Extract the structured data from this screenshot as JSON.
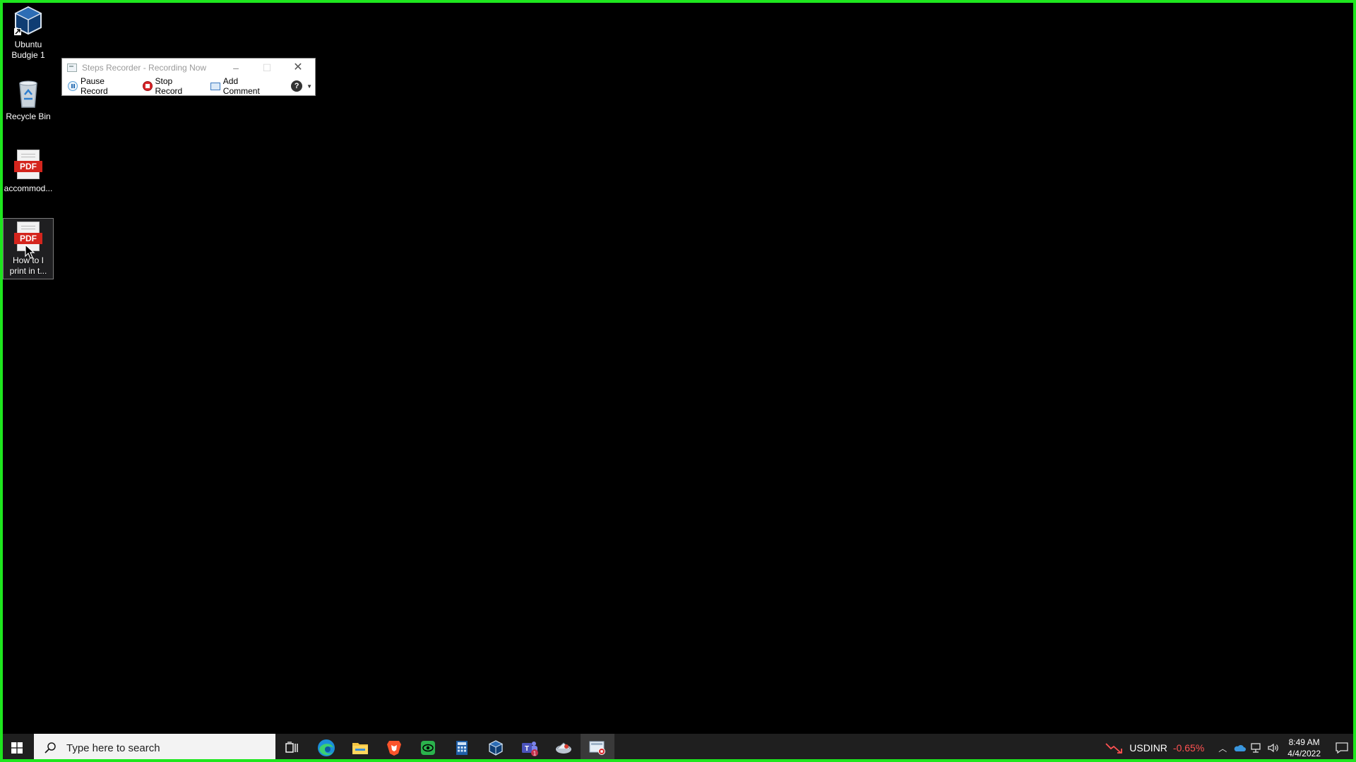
{
  "desktop": {
    "icons": [
      {
        "label": "Ubuntu Budgie 1",
        "icon": "virtualbox-vm-icon"
      },
      {
        "label": "Recycle Bin",
        "icon": "recycle-bin-icon"
      },
      {
        "label": "accommod...",
        "icon": "pdf-file-icon",
        "badge": "PDF"
      },
      {
        "label": "How to I print in t...",
        "icon": "pdf-file-icon",
        "badge": "PDF",
        "selected": true
      }
    ]
  },
  "steps_recorder": {
    "title": "Steps Recorder - Recording Now",
    "minimize": "–",
    "maximize": "☐",
    "close": "✕",
    "pause_label": "Pause Record",
    "stop_label": "Stop Record",
    "comment_label": "Add Comment",
    "help_label": "?"
  },
  "taskbar": {
    "search_placeholder": "Type here to search",
    "apps": [
      "task-view",
      "edge",
      "file-explorer",
      "brave",
      "vpn-app",
      "calculator",
      "virtualbox",
      "teams",
      "mail-app",
      "steps-recorder"
    ],
    "teams_badge": "1",
    "ticker_symbol": "USDINR",
    "ticker_change": "-0.65%",
    "time": "8:49 AM",
    "date": "4/4/2022"
  },
  "colors": {
    "frame": "#1ee61e",
    "taskbar": "#1f1f1f",
    "stop_red": "#d9262b",
    "ticker_down": "#ff5252"
  }
}
